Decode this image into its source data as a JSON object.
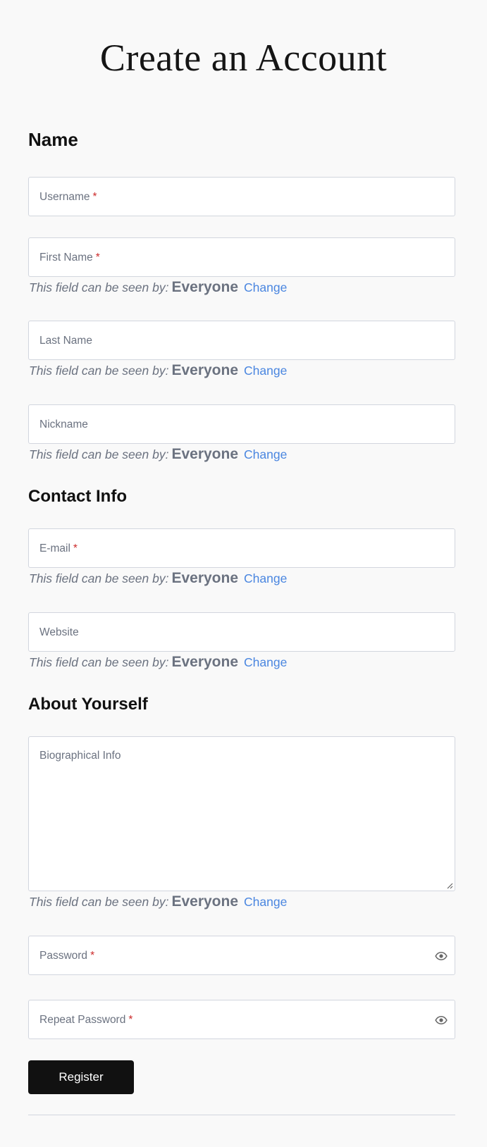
{
  "page": {
    "title": "Create an Account"
  },
  "sections": {
    "name": "Name",
    "contact": "Contact Info",
    "about": "About Yourself"
  },
  "fields": {
    "username": {
      "label": "Username",
      "required": "*"
    },
    "first_name": {
      "label": "First Name",
      "required": "*"
    },
    "last_name": {
      "label": "Last Name"
    },
    "nickname": {
      "label": "Nickname"
    },
    "email": {
      "label": "E-mail",
      "required": "*"
    },
    "website": {
      "label": "Website"
    },
    "bio": {
      "label": "Biographical Info"
    },
    "password": {
      "label": "Password",
      "required": "*",
      "icon": "eye-icon"
    },
    "repeat_password": {
      "label": "Repeat Password",
      "required": "*",
      "icon": "eye-icon"
    }
  },
  "visibility": {
    "label": "This field can be seen by:",
    "value": "Everyone",
    "change": "Change"
  },
  "actions": {
    "register": "Register"
  },
  "colors": {
    "background": "#f9f9f9",
    "button": "#111111",
    "link": "#4a86e0",
    "required": "#cc2b2b",
    "muted_text": "#6b7280",
    "border": "#d2d6de"
  }
}
